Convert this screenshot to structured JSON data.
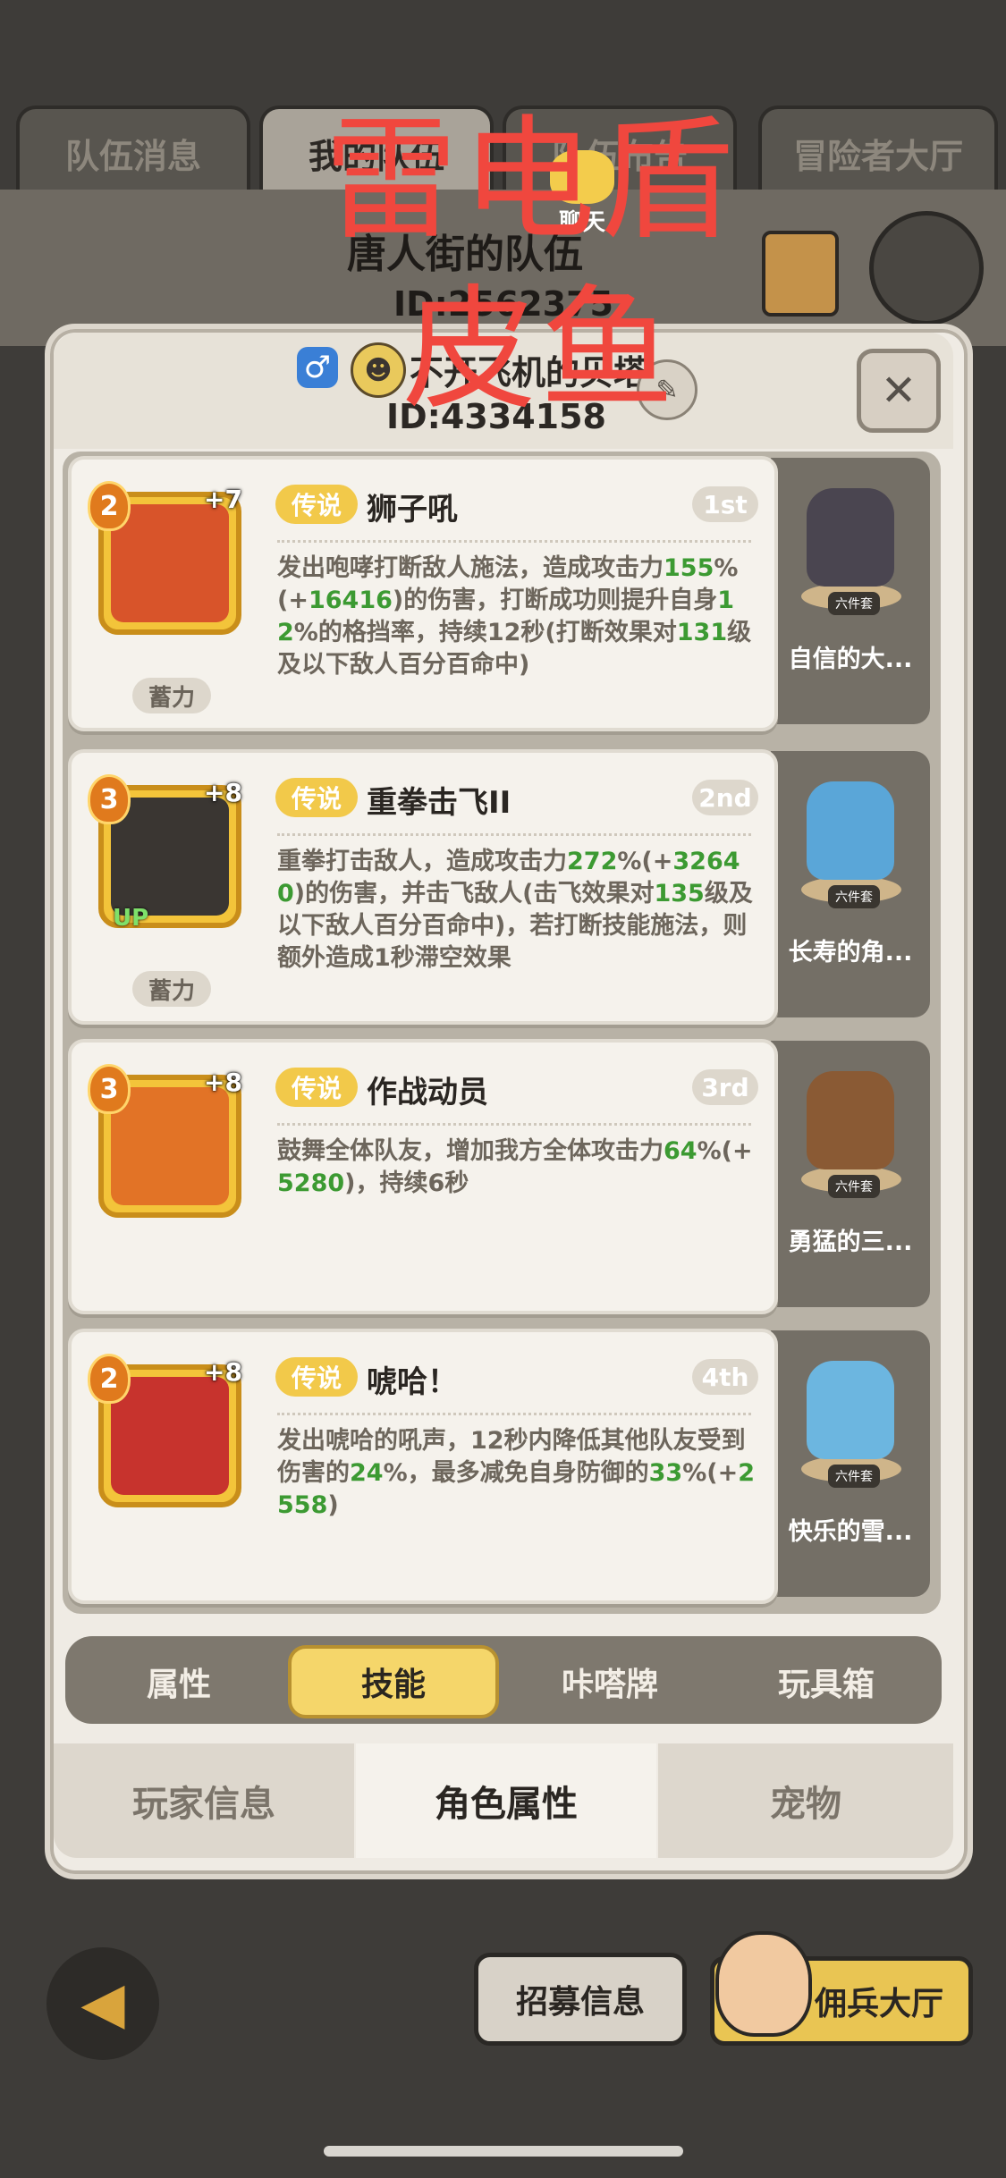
{
  "background": {
    "tabs": [
      "队伍消息",
      "我的队伍",
      "队伍布告",
      "冒险者大厅"
    ],
    "team_name": "唐人街的队伍",
    "team_id": "ID:2562375"
  },
  "chat_label": "聊天",
  "watermark": {
    "line1": "雷电盾",
    "line2": "皮鱼"
  },
  "player": {
    "gender_icon": "male-icon",
    "name": "不开飞机的贝塔",
    "id": "ID:4334158"
  },
  "skills": [
    {
      "level": "2",
      "plus": "+7",
      "tag": "传说",
      "name": "狮子吼",
      "rank": "1st",
      "charge": "蓄力",
      "up": "",
      "desc_parts": [
        {
          "t": "发出咆哮打断敌人施法，造成攻击力"
        },
        {
          "t": "155",
          "g": true
        },
        {
          "t": "%(+"
        },
        {
          "t": "16416",
          "g": true
        },
        {
          "t": ")的伤害，打断成功则提升自身"
        },
        {
          "t": "12",
          "g": true
        },
        {
          "t": "%的格挡率，持续12秒(打断效果对"
        },
        {
          "t": "131",
          "g": true
        },
        {
          "t": "级及以下敌人百分百命中)"
        }
      ],
      "side_name": "自信的大..."
    },
    {
      "level": "3",
      "plus": "+8",
      "tag": "传说",
      "name": "重拳击飞II",
      "rank": "2nd",
      "charge": "蓄力",
      "up": "UP",
      "desc_parts": [
        {
          "t": "重拳打击敌人，造成攻击力"
        },
        {
          "t": "272",
          "g": true
        },
        {
          "t": "%(+"
        },
        {
          "t": "32640",
          "g": true
        },
        {
          "t": ")的伤害，并击飞敌人(击飞效果对"
        },
        {
          "t": "135",
          "g": true
        },
        {
          "t": "级及以下敌人百分百命中)，若打断技能施法，则额外造成1秒滞空效果"
        }
      ],
      "side_name": "长寿的角..."
    },
    {
      "level": "3",
      "plus": "+8",
      "tag": "传说",
      "name": "作战动员",
      "rank": "3rd",
      "charge": "",
      "up": "",
      "desc_parts": [
        {
          "t": "鼓舞全体队友，增加我方全体攻击力"
        },
        {
          "t": "64",
          "g": true
        },
        {
          "t": "%(+"
        },
        {
          "t": "5280",
          "g": true
        },
        {
          "t": ")，持续6秒"
        }
      ],
      "side_name": "勇猛的三..."
    },
    {
      "level": "2",
      "plus": "+8",
      "tag": "传说",
      "name": "唬哈！",
      "rank": "4th",
      "charge": "",
      "up": "",
      "desc_parts": [
        {
          "t": "发出唬哈的吼声，12秒内降低其他队友受到伤害的"
        },
        {
          "t": "24",
          "g": true
        },
        {
          "t": "%，最多减免自身防御的"
        },
        {
          "t": "33",
          "g": true
        },
        {
          "t": "%(+"
        },
        {
          "t": "2558",
          "g": true
        },
        {
          "t": ")"
        }
      ],
      "side_name": "快乐的雪..."
    }
  ],
  "side_badge": "六件套",
  "subtabs": [
    "属性",
    "技能",
    "咔嗒牌",
    "玩具箱"
  ],
  "subtab_active": "技能",
  "bottom_tabs": [
    "玩家信息",
    "角色属性",
    "宠物"
  ],
  "bottom_active": "角色属性",
  "footer": {
    "recruit": "招募信息",
    "mercenary": "佣兵大厅"
  },
  "colors": {
    "accent_gold": "#f5d66a",
    "highlight_green": "#3c9a32",
    "tag_yellow": "#f2c94a"
  }
}
